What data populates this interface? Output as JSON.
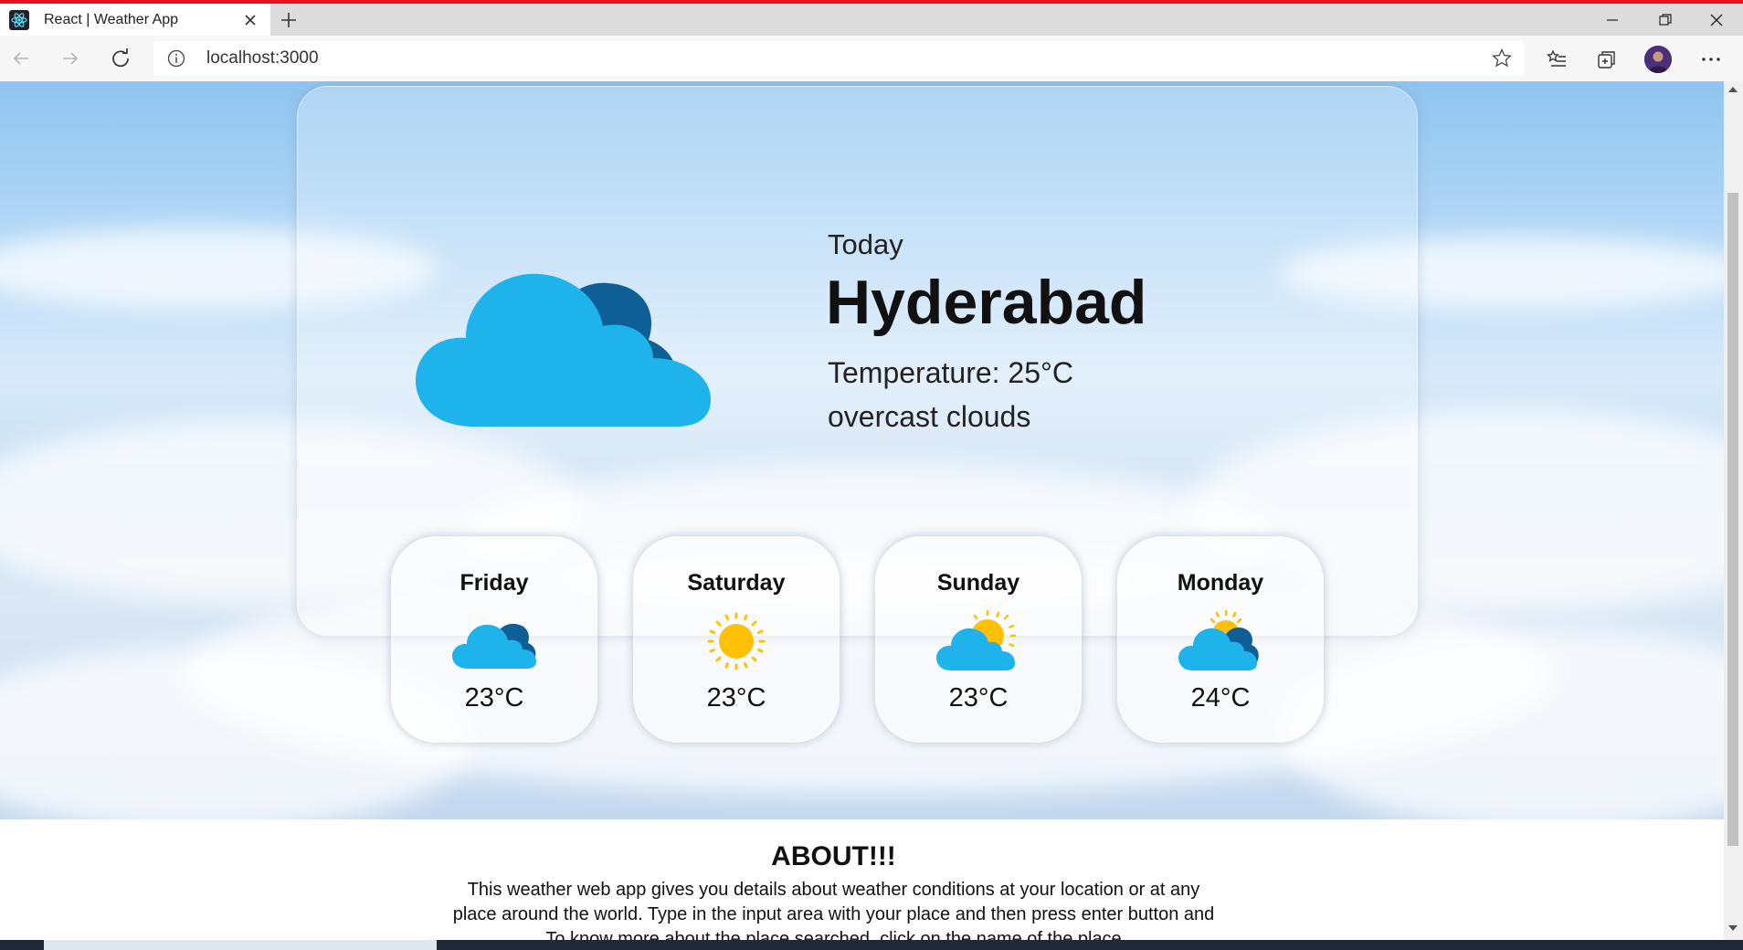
{
  "browser": {
    "tab_title": "React | Weather App",
    "url": "localhost:3000",
    "icons": {
      "favicon": "react-atom-icon",
      "tab_close": "close-icon",
      "new_tab": "plus-icon",
      "back": "arrow-left-icon",
      "forward": "arrow-right-icon",
      "refresh": "refresh-icon",
      "site_info": "info-icon",
      "favorite": "star-icon",
      "favorites_list": "favorites-icon",
      "collections": "collections-icon",
      "profile": "avatar",
      "menu": "more-icon"
    }
  },
  "weather": {
    "today_label": "Today",
    "city": "Hyderabad",
    "temperature": "Temperature: 25°C",
    "description": "overcast clouds",
    "icon": "cloud-icon"
  },
  "forecast": [
    {
      "day": "Friday",
      "temp": "23°C",
      "icon": "cloud-icon"
    },
    {
      "day": "Saturday",
      "temp": "23°C",
      "icon": "sun-icon"
    },
    {
      "day": "Sunday",
      "temp": "23°C",
      "icon": "partly-sunny-icon"
    },
    {
      "day": "Monday",
      "temp": "24°C",
      "icon": "cloudy-sun-icon"
    }
  ],
  "about": {
    "title": "ABOUT!!!",
    "line1": "This weather web app gives you details about weather conditions at your location or at any",
    "line2": "place around the world. Type in the input area with your place and then press enter button and",
    "line3": "To know more about the place searched, click on the name of the place"
  },
  "colors": {
    "cloud_light": "#1eb3ea",
    "cloud_dark": "#0f5f97",
    "sun": "#ffc107",
    "accent_red": "#e81123"
  }
}
